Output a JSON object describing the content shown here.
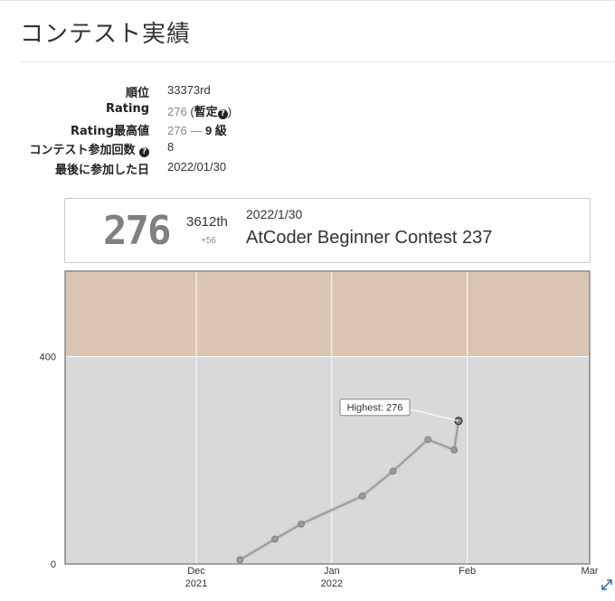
{
  "page": {
    "title": "コンテスト実績"
  },
  "stats": {
    "rank_label": "順位",
    "rank_value": "33373rd",
    "rating_label": "Rating",
    "rating_value": "276",
    "rating_note_open": "(",
    "rating_note": "暫定",
    "rating_note_close": ")",
    "highest_label": "Rating最高値",
    "highest_value": "276",
    "highest_dash": "—",
    "highest_grade": "9 級",
    "count_label": "コンテスト参加回数",
    "count_value": "8",
    "last_label": "最後に参加した日",
    "last_value": "2022/01/30",
    "question_glyph": "?"
  },
  "contest_card": {
    "rating": "276",
    "place": "3612th",
    "diff": "+56",
    "date": "2022/1/30",
    "name": "AtCoder Beginner Contest 237"
  },
  "chart_data": {
    "type": "line",
    "x_type": "date",
    "xlim": [
      "2021-11-01",
      "2022-03-01"
    ],
    "ylim": [
      0,
      565
    ],
    "y_ticks": [
      0,
      400
    ],
    "x_ticks": [
      {
        "date": "2021-12-01",
        "label": "Dec",
        "sublabel": "2021"
      },
      {
        "date": "2022-01-01",
        "label": "Jan",
        "sublabel": "2022"
      },
      {
        "date": "2022-02-01",
        "label": "Feb",
        "sublabel": ""
      },
      {
        "date": "2022-03-01",
        "label": "Mar",
        "sublabel": ""
      }
    ],
    "bands": [
      {
        "from": 0,
        "to": 400,
        "color": "#d9d9d9"
      },
      {
        "from": 400,
        "to": 565,
        "color": "#d9c5b2"
      }
    ],
    "series": [
      {
        "color": "#9a9a9a",
        "points": [
          {
            "x": "2021-12-11",
            "y": 8
          },
          {
            "x": "2021-12-19",
            "y": 48
          },
          {
            "x": "2021-12-25",
            "y": 77
          },
          {
            "x": "2022-01-08",
            "y": 131
          },
          {
            "x": "2022-01-15",
            "y": 179
          },
          {
            "x": "2022-01-23",
            "y": 240
          },
          {
            "x": "2022-01-29",
            "y": 220
          },
          {
            "x": "2022-01-30",
            "y": 276
          }
        ]
      }
    ],
    "annotation": {
      "text": "Highest: 276",
      "x": "2022-01-30",
      "y": 276
    },
    "border_color": "#888888"
  },
  "icons": {
    "expand": "expand-icon",
    "help": "question-circle-icon"
  }
}
